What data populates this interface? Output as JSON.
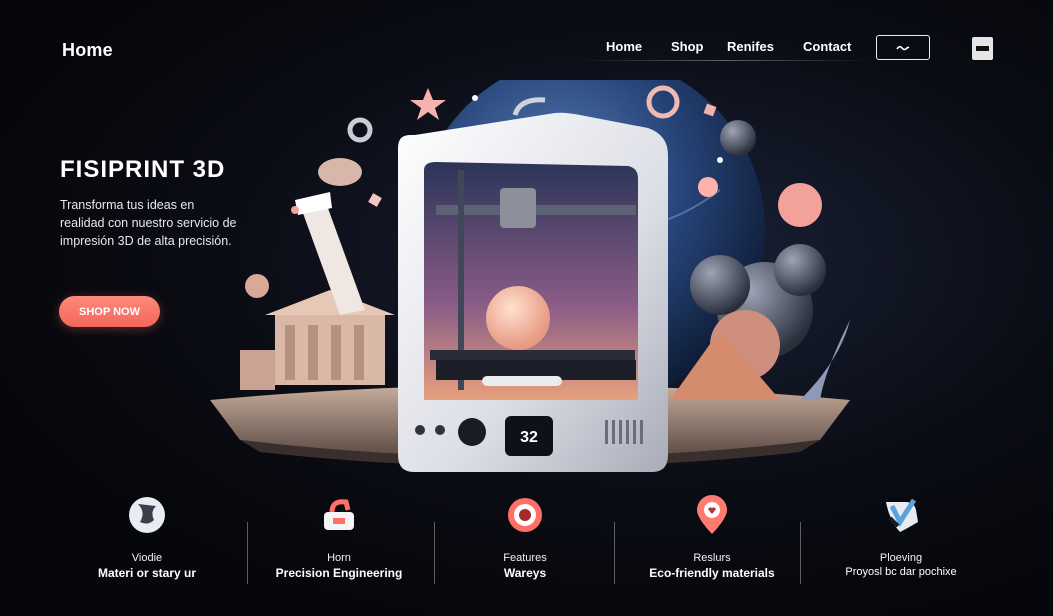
{
  "header": {
    "logo": "Home",
    "nav": [
      "Home",
      "Shop",
      "Renifes",
      "Contact"
    ],
    "search_icon": "wave-icon",
    "menu_icon": "menu-icon"
  },
  "hero": {
    "title": "FISIPRINT 3D",
    "description": "Transforma tus ideas en realidad con nuestro servicio de impresión 3D de alta precisión.",
    "cta": "SHOP NOW",
    "printer_display": "32"
  },
  "features": [
    {
      "icon": "globe-icon",
      "line1": "Viodie",
      "line2": "Materi or stary ur"
    },
    {
      "icon": "printer-icon",
      "line1": "Horn",
      "line2": "Precision Engineering"
    },
    {
      "icon": "target-icon",
      "line1": "Features",
      "line2": "Wareys"
    },
    {
      "icon": "location-pin-icon",
      "line1": "Reslurs",
      "line2": "Eco-friendly materials"
    },
    {
      "icon": "shield-check-icon",
      "line1": "Ploeving",
      "line2": "Proyosl bc dar pochixe"
    }
  ],
  "colors": {
    "accent": "#f2665a",
    "background": "#07080c",
    "text": "#ffffff"
  }
}
